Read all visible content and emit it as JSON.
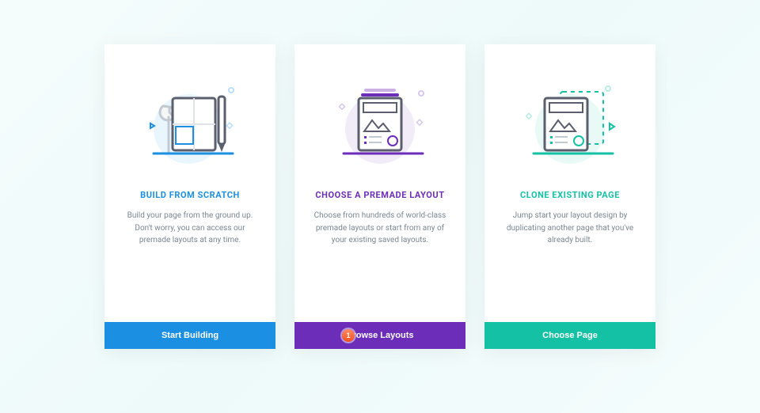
{
  "cards": {
    "scratch": {
      "title": "BUILD FROM SCRATCH",
      "body": "Build your page from the ground up. Don't worry, you can access our premade layouts at any time.",
      "cta": "Start Building"
    },
    "premade": {
      "title": "CHOOSE A PREMADE LAYOUT",
      "body": "Choose from hundreds of world-class premade layouts or start from any of your existing saved layouts.",
      "cta": "Browse Layouts",
      "badge": "1"
    },
    "clone": {
      "title": "CLONE EXISTING PAGE",
      "body": "Jump start your layout design by duplicating another page that you've already built.",
      "cta": "Choose Page"
    }
  }
}
